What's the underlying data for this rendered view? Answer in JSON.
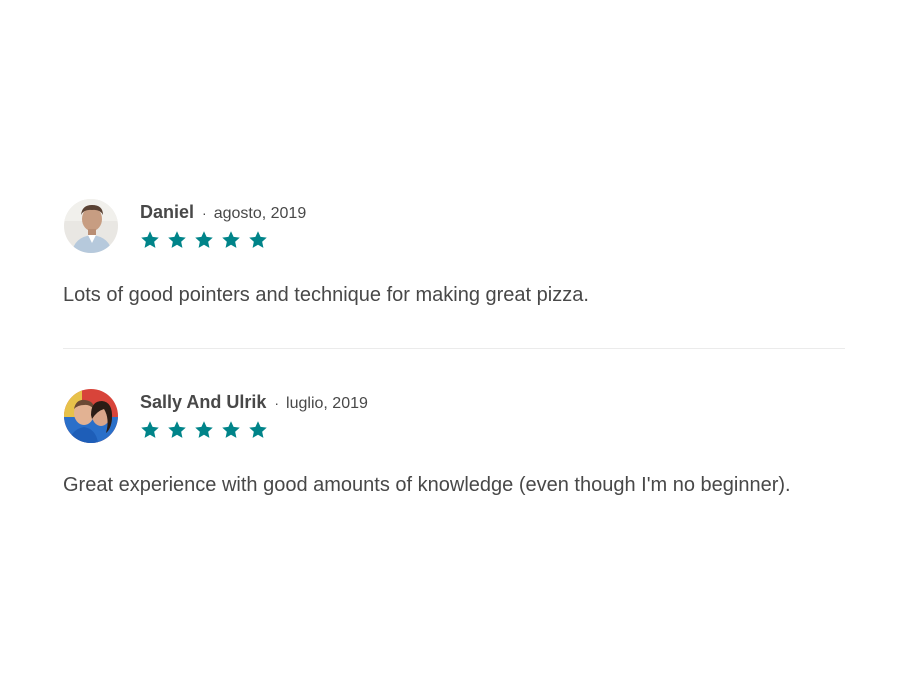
{
  "reviews": [
    {
      "name": "Daniel",
      "separator": "·",
      "date": "agosto, 2019",
      "rating": 5,
      "text": "Lots of good pointers and technique for making great pizza.",
      "avatar_icon": "person-photo-avatar"
    },
    {
      "name": "Sally And Ulrik",
      "separator": "·",
      "date": "luglio, 2019",
      "rating": 5,
      "text": "Great experience with good amounts of knowledge (even though I'm no beginner).",
      "avatar_icon": "couple-photo-avatar"
    }
  ],
  "colors": {
    "star": "#008489",
    "text": "#484848",
    "divider": "#ebebeb"
  }
}
